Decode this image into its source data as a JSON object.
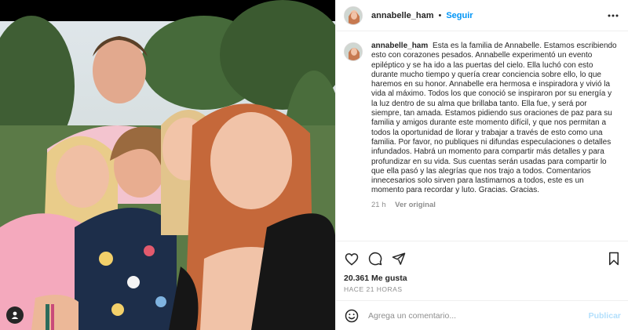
{
  "post": {
    "username": "annabelle_ham",
    "follow_label": "Seguir",
    "separator": "•",
    "caption": "Esta es la familia de Annabelle. Estamos escribiendo esto con corazones pesados. Annabelle experimentó un evento epiléptico y se ha ido a las puertas del cielo. Ella luchó con esto durante mucho tiempo y quería crear conciencia sobre ello, lo que haremos en su honor. Annabelle era hermosa e inspiradora y vivió la vida al máximo. Todos los que conoció se inspiraron por su energía y la luz dentro de su alma que brillaba tanto. Ella fue, y será por siempre, tan amada. Estamos pidiendo sus oraciones de paz para su familia y amigos durante este momento difícil, y que nos permitan a todos la oportunidad de llorar y trabajar a través de esto como una familia. Por favor, no publiques ni difundas especulaciones o detalles infundados. Habrá un momento para compartir más detalles y para profundizar en su vida. Sus cuentas serán usadas para compartir lo que ella pasó y las alegrías que nos trajo a todos. Comentarios innecesarios solo sirven para lastimarnos a todos, este es un momento para recordar y luto. Gracias. Gracias.",
    "caption_age": "21 h",
    "see_original": "Ver original",
    "likes": "20.361 Me gusta",
    "posted_ago": "HACE 21 HORAS"
  },
  "comment_box": {
    "placeholder": "Agrega un comentario...",
    "post_label": "Publicar"
  },
  "icons": {
    "header_more": "more-horizontal-icon",
    "like": "heart-icon",
    "comment": "comment-icon",
    "share": "paper-plane-icon",
    "save": "bookmark-icon",
    "emoji": "emoji-icon",
    "user_tag": "user-tag-icon"
  },
  "colors": {
    "link_blue": "#0095f6",
    "muted": "#8e8e8e",
    "text": "#262626",
    "post_disabled": "#b2dffc"
  }
}
